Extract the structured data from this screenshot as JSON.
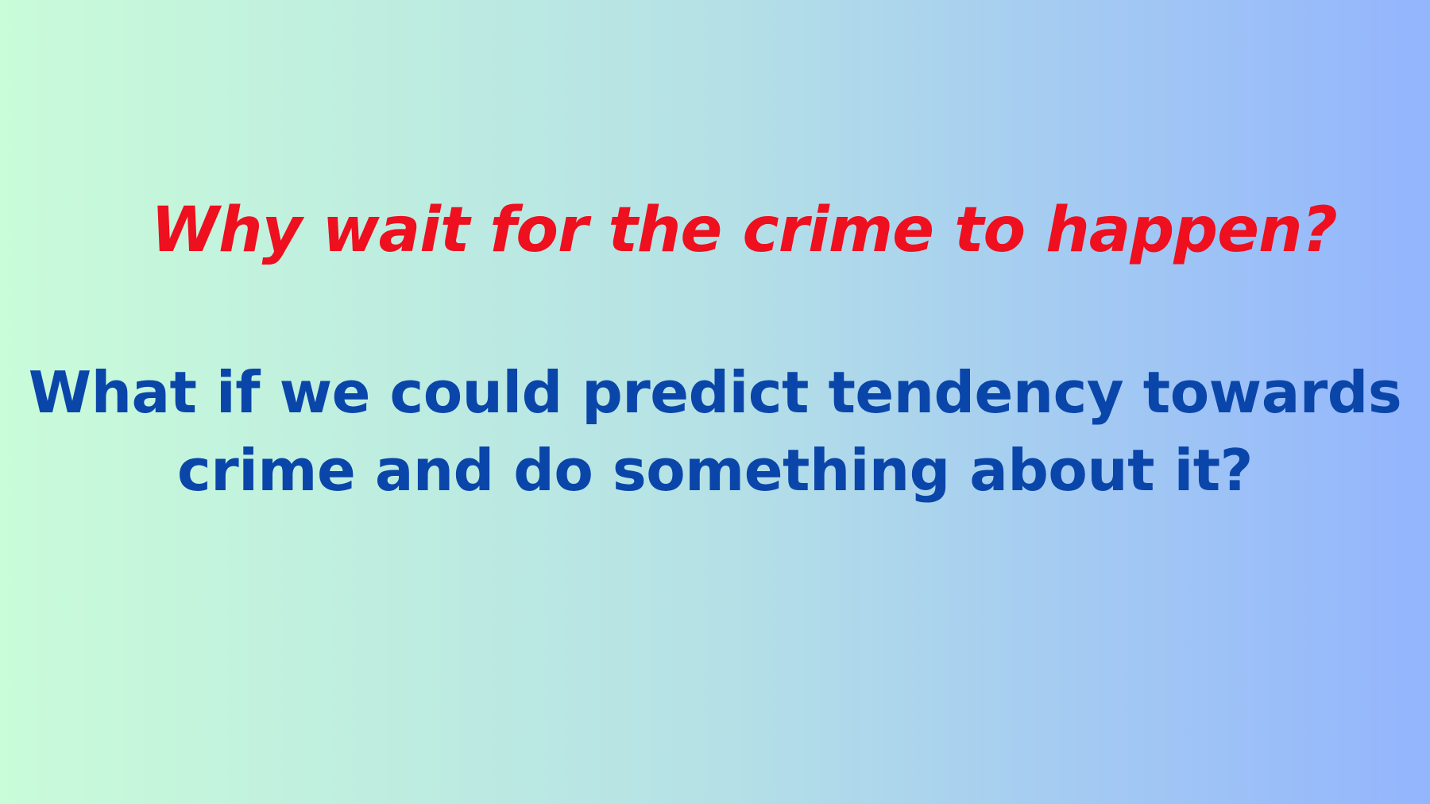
{
  "slide": {
    "gradient_start": "#c9fcd9",
    "gradient_mid": "#b5e1e6",
    "gradient_end": "#93b5fd",
    "headline": {
      "text": "Why wait for the crime to happen?",
      "color": "#ee0f1f"
    },
    "question": {
      "line1": "What if we could predict tendency towards",
      "line2": "crime and do something about it?",
      "color": "#0a46aa"
    }
  }
}
